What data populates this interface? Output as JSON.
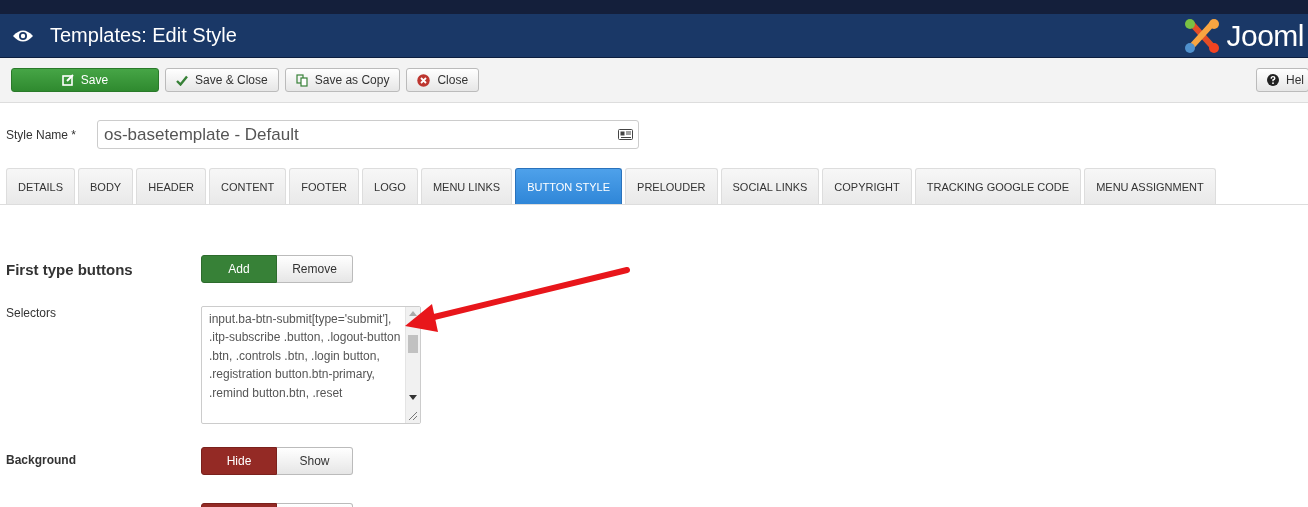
{
  "header": {
    "title": "Templates: Edit Style",
    "logo": "Jooml"
  },
  "toolbar": {
    "buttons": [
      {
        "label": "Save",
        "kind": "primary"
      },
      {
        "label": "Save & Close",
        "kind": "default"
      },
      {
        "label": "Save as Copy",
        "kind": "default"
      },
      {
        "label": "Close",
        "kind": "default"
      }
    ],
    "help": {
      "label": "Hel"
    }
  },
  "style_name": {
    "label": "Style Name *",
    "value": "os-basetemplate - Default"
  },
  "tabs": [
    {
      "label": "DETAILS",
      "selected": false
    },
    {
      "label": "BODY",
      "selected": false
    },
    {
      "label": "HEADER",
      "selected": false
    },
    {
      "label": "CONTENT",
      "selected": false
    },
    {
      "label": "FOOTER",
      "selected": false
    },
    {
      "label": "LOGO",
      "selected": false
    },
    {
      "label": "MENU LINKS",
      "selected": false
    },
    {
      "label": "BUTTON STYLE",
      "selected": true
    },
    {
      "label": "PRELOUDER",
      "selected": false
    },
    {
      "label": "SOCIAL LINKS",
      "selected": false
    },
    {
      "label": "COPYRIGHT",
      "selected": false
    },
    {
      "label": "TRACKING GOOGLE CODE",
      "selected": false
    },
    {
      "label": "MENU ASSIGNMENT",
      "selected": false
    }
  ],
  "fields": [
    {
      "kind": "heading",
      "label": "First type buttons",
      "options": [
        {
          "label": "Add",
          "selected": true
        },
        {
          "label": "Remove",
          "selected": false
        }
      ]
    },
    {
      "kind": "textarea",
      "label": "Selectors",
      "value": "input.ba-btn-submit[type='submit'], .itp-subscribe .button, .logout-button .btn, .controls .btn, .login button, .registration button.btn-primary, .remind button.btn, .reset"
    },
    {
      "kind": "toggle",
      "label": "Background",
      "options": [
        {
          "label": "Hide",
          "selected": true
        },
        {
          "label": "Show",
          "selected": false
        }
      ]
    },
    {
      "kind": "toggle",
      "options": [
        {
          "selected": true
        },
        {
          "selected": false
        }
      ]
    }
  ]
}
